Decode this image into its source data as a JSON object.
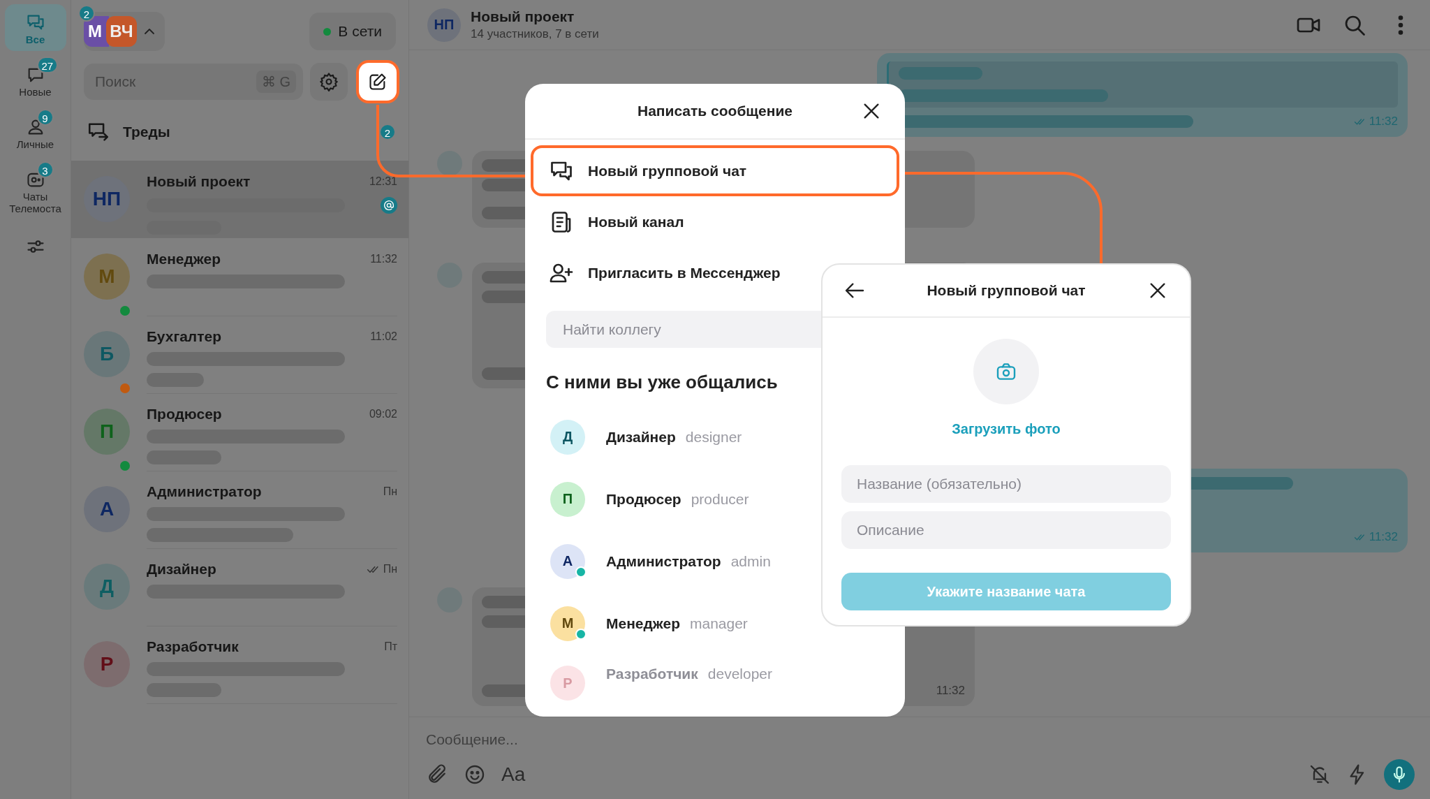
{
  "rail": {
    "items": [
      {
        "label": "Все",
        "selected": true
      },
      {
        "label": "Новые",
        "badge": "27",
        "selected": false
      },
      {
        "label": "Личные",
        "badge": "9",
        "selected": false
      },
      {
        "label": "Чаты Телемоста",
        "badge": "3",
        "selected": false
      }
    ]
  },
  "account": {
    "badge": "2",
    "avatars": [
      {
        "initials": "М",
        "color": "#6a4fa6"
      },
      {
        "initials": "ВЧ",
        "color": "#c4572a"
      }
    ],
    "status": "В сети"
  },
  "search": {
    "placeholder": "Поиск",
    "shortcut": "⌘ G"
  },
  "compose_button": {
    "highlighted": true
  },
  "threads": {
    "label": "Треды",
    "badge": "2"
  },
  "chats": [
    {
      "kind": "two_line",
      "initials": "НП",
      "name": "Новый проект",
      "time": "12:31",
      "color": "#6e727b",
      "online": false,
      "away": false,
      "mention": true,
      "read": false,
      "selected": true
    },
    {
      "kind": "one_line",
      "initials": "М",
      "name": "Менеджер",
      "time": "11:32",
      "color": "#7d7050",
      "online": true,
      "away": false,
      "mention": false,
      "read": false,
      "selected": false
    },
    {
      "kind": "two_line",
      "initials": "Б",
      "name": "Бухгалтер",
      "time": "11:02",
      "color": "#697779",
      "online": false,
      "away": true,
      "mention": false,
      "read": false,
      "selected": false
    },
    {
      "kind": "two_line",
      "initials": "П",
      "name": "Продюсер",
      "time": "09:02",
      "color": "#647867",
      "online": true,
      "away": false,
      "mention": false,
      "read": false,
      "selected": false
    },
    {
      "kind": "two_line",
      "initials": "А",
      "name": "Администратор",
      "time": "Пн",
      "color": "#6e727b",
      "online": false,
      "away": false,
      "mention": false,
      "read": false,
      "selected": false
    },
    {
      "kind": "one_line",
      "initials": "Д",
      "name": "Дизайнер",
      "time": "Пн",
      "color": "#697a7b",
      "online": false,
      "away": false,
      "mention": false,
      "read": true,
      "selected": false
    },
    {
      "kind": "two_line",
      "initials": "Р",
      "name": "Разработчик",
      "time": "Пт",
      "color": "#7d6c6e",
      "online": false,
      "away": false,
      "mention": false,
      "read": false,
      "selected": false
    }
  ],
  "chat_header": {
    "initials": "НП",
    "title": "Новый проект",
    "subtitle": "14 участников, 7 в сети"
  },
  "messages": [
    {
      "kind": "outgoing",
      "time": "11:32",
      "read": true
    },
    {
      "kind": "incoming"
    },
    {
      "kind": "incoming"
    },
    {
      "kind": "outgoing",
      "time": "11:32",
      "read": true
    },
    {
      "kind": "incoming",
      "time": "11:32"
    }
  ],
  "composer": {
    "placeholder": "Сообщение...",
    "format_label": "Aa"
  },
  "compose_dialog": {
    "title": "Написать сообщение",
    "actions": [
      {
        "label": "Новый групповой чат",
        "highlighted": true
      },
      {
        "label": "Новый канал",
        "highlighted": false
      },
      {
        "label": "Пригласить в Мессенджер",
        "highlighted": false
      }
    ],
    "search_placeholder": "Найти коллегу",
    "section_title": "С ними вы уже общались",
    "contacts": [
      {
        "initials": "Д",
        "name": "Дизайнер",
        "login": "designer",
        "color": "#d3f1f6",
        "online": false,
        "faded": false
      },
      {
        "initials": "П",
        "name": "Продюсер",
        "login": "producer",
        "color": "#c8f0cf",
        "online": false,
        "faded": false
      },
      {
        "initials": "А",
        "name": "Администратор",
        "login": "admin",
        "color": "#dde4f6",
        "online": true,
        "faded": false
      },
      {
        "initials": "М",
        "name": "Менеджер",
        "login": "manager",
        "color": "#fbe0a0",
        "online": true,
        "faded": false
      },
      {
        "initials": "Р",
        "name": "Разработчик",
        "login": "developer",
        "color": "#fbe3e6",
        "online": false,
        "faded": true
      }
    ]
  },
  "group_dialog": {
    "title": "Новый групповой чат",
    "upload_label": "Загрузить фото",
    "name_placeholder": "Название (обязательно)",
    "description_placeholder": "Описание",
    "submit_label": "Укажите название чата",
    "disabled": true
  }
}
